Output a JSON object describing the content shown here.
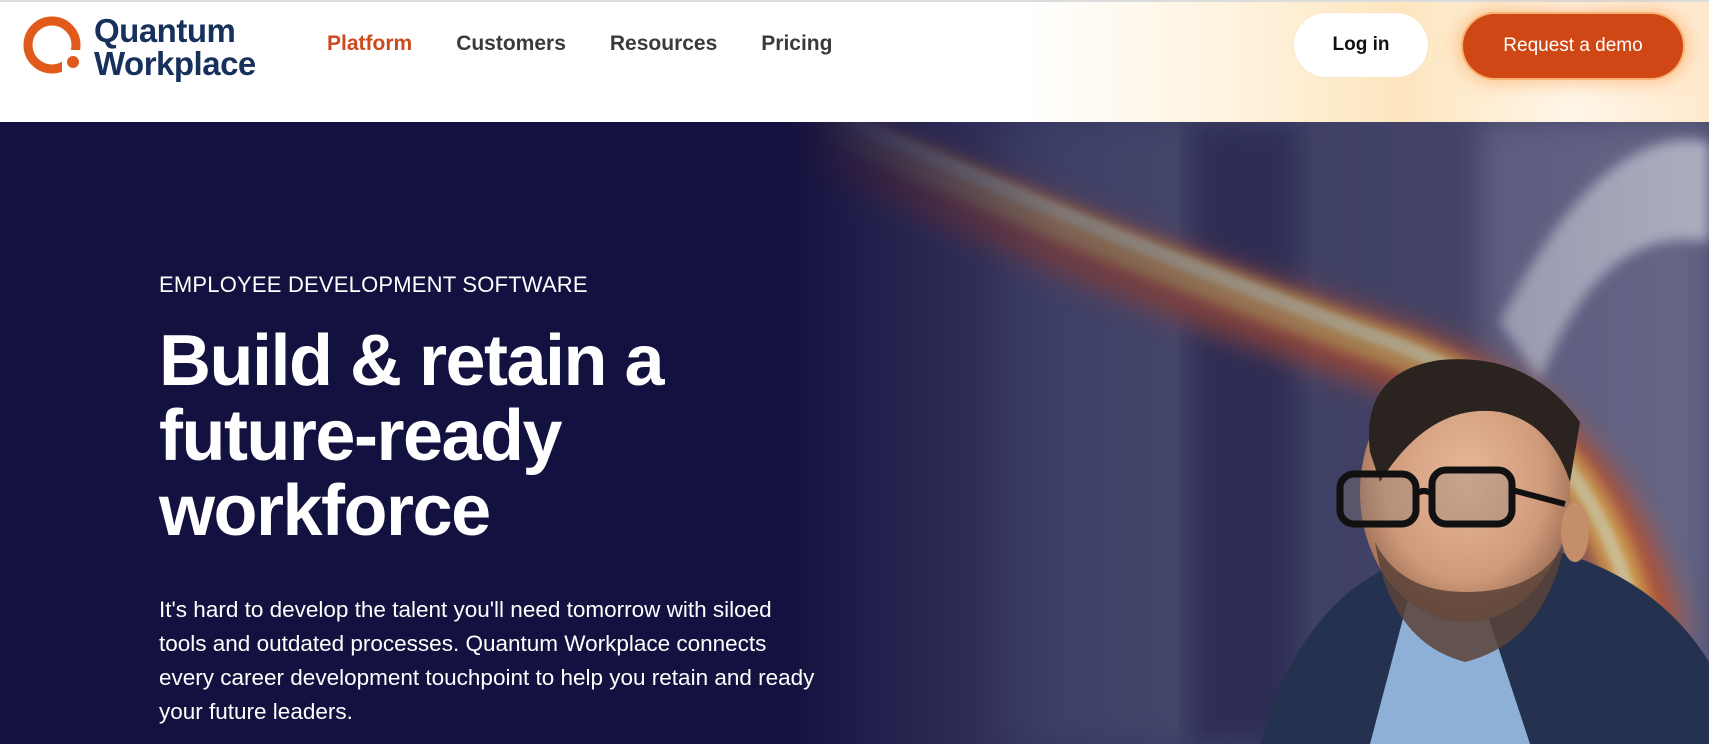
{
  "brand": {
    "line1": "Quantum",
    "line2": "Workplace",
    "colors": {
      "navy": "#17315c",
      "orange": "#e05a1c"
    }
  },
  "nav": {
    "items": [
      {
        "label": "Platform",
        "active": true
      },
      {
        "label": "Customers",
        "active": false
      },
      {
        "label": "Resources",
        "active": false
      },
      {
        "label": "Pricing",
        "active": false
      }
    ]
  },
  "header": {
    "login_label": "Log in",
    "demo_label": "Request a demo"
  },
  "hero": {
    "eyebrow": "EMPLOYEE DEVELOPMENT SOFTWARE",
    "headline": "Build & retain a future-ready workforce",
    "body": "It's hard to develop the talent you'll need tomorrow with siloed tools and outdated processes. Quantum Workplace connects every career development touchpoint to help you retain and ready your future leaders.",
    "image": "smiling-man-with-glasses-photo",
    "colors": {
      "background": "#13113f",
      "accent_glow": "#f7a23c",
      "cta": "#cf4714"
    }
  }
}
